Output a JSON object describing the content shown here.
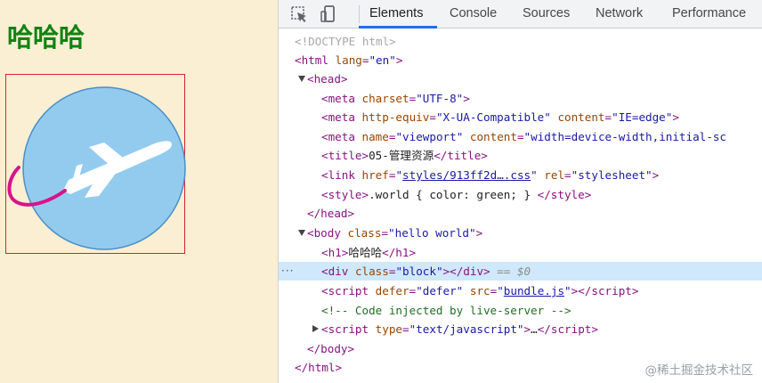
{
  "page": {
    "heading": "哈哈哈",
    "background_color": "#faeed3",
    "heading_color": "#108310",
    "block_border_color": "#e0202c",
    "illustration": "airplane-in-circle"
  },
  "devtools": {
    "toolbar": {
      "icons": [
        "inspect-element-icon",
        "device-toolbar-icon"
      ],
      "tabs": [
        {
          "label": "Elements",
          "active": true
        },
        {
          "label": "Console"
        },
        {
          "label": "Sources"
        },
        {
          "label": "Network"
        },
        {
          "label": "Performance"
        }
      ]
    },
    "dom": {
      "doctype": "<!DOCTYPE html>",
      "html_open_tag": "html",
      "html_lang_attr": "lang",
      "html_lang_val": "\"en\"",
      "head_tag": "head",
      "meta1_attr": "charset",
      "meta1_val": "\"UTF-8\"",
      "meta2_attr1": "http-equiv",
      "meta2_val1": "\"X-UA-Compatible\"",
      "meta2_attr2": "content",
      "meta2_val2": "\"IE=edge\"",
      "meta3_attr1": "name",
      "meta3_val1": "\"viewport\"",
      "meta3_attr2": "content",
      "meta3_val2": "\"width=device-width,initial-sc",
      "title_text": "05-管理资源",
      "link_attr1": "href",
      "link_val": "styles/913ff2d….css",
      "link_attr2": "rel",
      "link_val2": "\"stylesheet\"",
      "style_text": ".world { color: green; } ",
      "body_attr": "class",
      "body_val": "\"hello world\"",
      "h1_text": "哈哈哈",
      "div_attr": "class",
      "div_val": "\"block\"",
      "selected_marker": "== $0",
      "script1_attr1": "defer",
      "script1_val1": "\"defer\"",
      "script1_attr2": "src",
      "script1_val2": "bundle.js",
      "comment": "<!-- Code injected by live-server -->",
      "script2_attr": "type",
      "script2_val": "\"text/javascript\"",
      "ellipsis": "…",
      "row_menu": "···"
    },
    "watermark": "@稀土掘金技术社区"
  }
}
